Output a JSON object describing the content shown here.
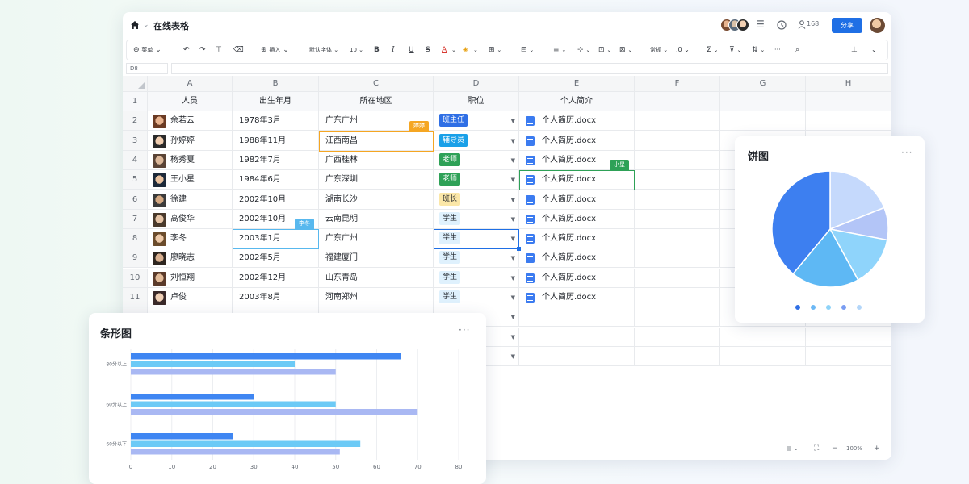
{
  "app": {
    "title": "在线表格",
    "collaborator_count": "168",
    "share_label": "分享"
  },
  "toolbar": {
    "menu_label": "菜单",
    "insert_label": "插入",
    "font_label": "默认字体",
    "font_size": "10",
    "number_format": "常规"
  },
  "formula_bar": {
    "cell_ref": "D8"
  },
  "columns": [
    "A",
    "B",
    "C",
    "D",
    "E",
    "F",
    "G",
    "H"
  ],
  "headers": [
    "人员",
    "出生年月",
    "所在地区",
    "职位",
    "个人简介"
  ],
  "rows": [
    {
      "num": "2",
      "name": "余若云",
      "birth": "1978年3月",
      "region": "广东广州",
      "role": "班主任",
      "role_color": "#2f6fe5",
      "file": "个人简历.docx"
    },
    {
      "num": "3",
      "name": "孙婷婷",
      "birth": "1988年11月",
      "region": "江西南昌",
      "role": "辅导员",
      "role_color": "#1aa0e8",
      "file": "个人简历.docx"
    },
    {
      "num": "4",
      "name": "杨秀夏",
      "birth": "1982年7月",
      "region": "广西桂林",
      "role": "老师",
      "role_color": "#2ea157",
      "file": "个人简历.docx"
    },
    {
      "num": "5",
      "name": "王小星",
      "birth": "1984年6月",
      "region": "广东深圳",
      "role": "老师",
      "role_color": "#2ea157",
      "file": "个人简历.docx"
    },
    {
      "num": "6",
      "name": "徐建",
      "birth": "2002年10月",
      "region": "湖南长沙",
      "role": "班长",
      "role_color": "#fbe7a8",
      "file": "个人简历.docx"
    },
    {
      "num": "7",
      "name": "高俊华",
      "birth": "2002年10月",
      "region": "云南昆明",
      "role": "学生",
      "role_color": "#dff1fd",
      "file": "个人简历.docx"
    },
    {
      "num": "8",
      "name": "李冬",
      "birth": "2003年1月",
      "region": "广东广州",
      "role": "学生",
      "role_color": "#dff1fd",
      "file": "个人简历.docx"
    },
    {
      "num": "9",
      "name": "廖晓志",
      "birth": "2002年5月",
      "region": "福建厦门",
      "role": "学生",
      "role_color": "#dff1fd",
      "file": "个人简历.docx"
    },
    {
      "num": "10",
      "name": "刘恒翔",
      "birth": "2002年12月",
      "region": "山东青岛",
      "role": "学生",
      "role_color": "#dff1fd",
      "file": "个人简历.docx"
    },
    {
      "num": "11",
      "name": "卢俊",
      "birth": "2003年8月",
      "region": "河南郑州",
      "role": "学生",
      "role_color": "#dff1fd",
      "file": "个人简历.docx"
    }
  ],
  "cursors": [
    {
      "label": "婷婷",
      "color": "#f5a623"
    },
    {
      "label": "李冬",
      "color": "#58b8ee"
    },
    {
      "label": "小星",
      "color": "#2ea157"
    }
  ],
  "status": {
    "zoom": "100%"
  },
  "pie_card": {
    "title": "饼图",
    "chart_data": {
      "type": "pie",
      "slices": [
        {
          "value": 19,
          "color": "#c5d9fc"
        },
        {
          "value": 9,
          "color": "#b3c5f7"
        },
        {
          "value": 14,
          "color": "#8fd4fb"
        },
        {
          "value": 19,
          "color": "#5eb8f4"
        },
        {
          "value": 39,
          "color": "#3d7ff0"
        }
      ],
      "page_dots": 5,
      "active_dot": 0
    }
  },
  "bar_card": {
    "title": "条形图",
    "chart_data": {
      "type": "bar",
      "orientation": "horizontal",
      "categories": [
        "80分以上",
        "60分以上",
        "60分以下"
      ],
      "series": [
        {
          "values": [
            66,
            30,
            25
          ],
          "color": "#3f86f2"
        },
        {
          "values": [
            40,
            50,
            56
          ],
          "color": "#6ccaf6"
        },
        {
          "values": [
            50,
            70,
            51
          ],
          "color": "#a9b8f3"
        }
      ],
      "xlim": [
        0,
        80
      ],
      "xticks": [
        "0",
        "10",
        "20",
        "30",
        "40",
        "50",
        "60",
        "70",
        "80"
      ]
    }
  }
}
